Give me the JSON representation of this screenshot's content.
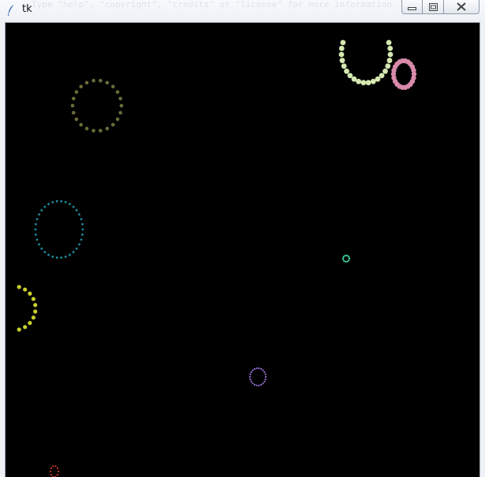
{
  "window": {
    "title": "tk",
    "background_artifact_text": "Type \"help\", \"copyright\", \"credits\" or \"license\" for more information."
  },
  "controls": {
    "minimize_icon": "minimize-icon",
    "maximize_icon": "maximize-icon",
    "close_icon": "close-icon"
  },
  "canvas": {
    "background": "#000000",
    "rings": [
      {
        "name": "ring-olive",
        "color": "#6b6b3a"
      },
      {
        "name": "ring-pale-green",
        "color": "#d4e8b0"
      },
      {
        "name": "ring-pink",
        "color": "#d88aa8"
      },
      {
        "name": "ring-teal",
        "color": "#1f8aa0"
      },
      {
        "name": "ring-yellow",
        "color": "#c9cf2a"
      },
      {
        "name": "ring-green",
        "color": "#38d49a"
      },
      {
        "name": "ring-purple",
        "color": "#9a72d8"
      },
      {
        "name": "ring-red",
        "color": "#d23a2a"
      }
    ]
  }
}
